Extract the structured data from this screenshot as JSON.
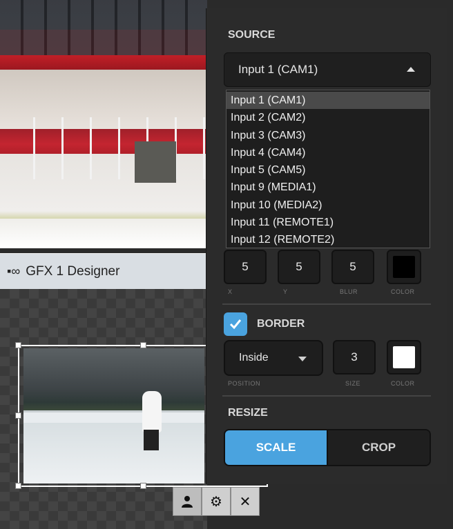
{
  "designer": {
    "title": "GFX 1 Designer"
  },
  "source": {
    "heading": "SOURCE",
    "selected": "Input 1 (CAM1)",
    "options": [
      "Input 1 (CAM1)",
      "Input 2 (CAM2)",
      "Input 3 (CAM3)",
      "Input 4 (CAM4)",
      "Input 5 (CAM5)",
      "Input 9 (MEDIA1)",
      "Input 10 (MEDIA2)",
      "Input 11 (REMOTE1)",
      "Input 12 (REMOTE2)"
    ]
  },
  "shadow": {
    "x": "5",
    "y": "5",
    "blur": "5",
    "x_label": "X",
    "y_label": "Y",
    "blur_label": "BLUR",
    "color_label": "COLOR",
    "color": "#000000"
  },
  "border": {
    "heading": "BORDER",
    "enabled": true,
    "position": "Inside",
    "position_label": "POSITION",
    "size": "3",
    "size_label": "SIZE",
    "color_label": "COLOR",
    "color": "#ffffff"
  },
  "resize": {
    "heading": "RESIZE",
    "scale_label": "SCALE",
    "crop_label": "CROP",
    "active": "SCALE"
  },
  "colors": {
    "accent": "#4aa3df",
    "panel_bg": "#2b2b2b"
  }
}
